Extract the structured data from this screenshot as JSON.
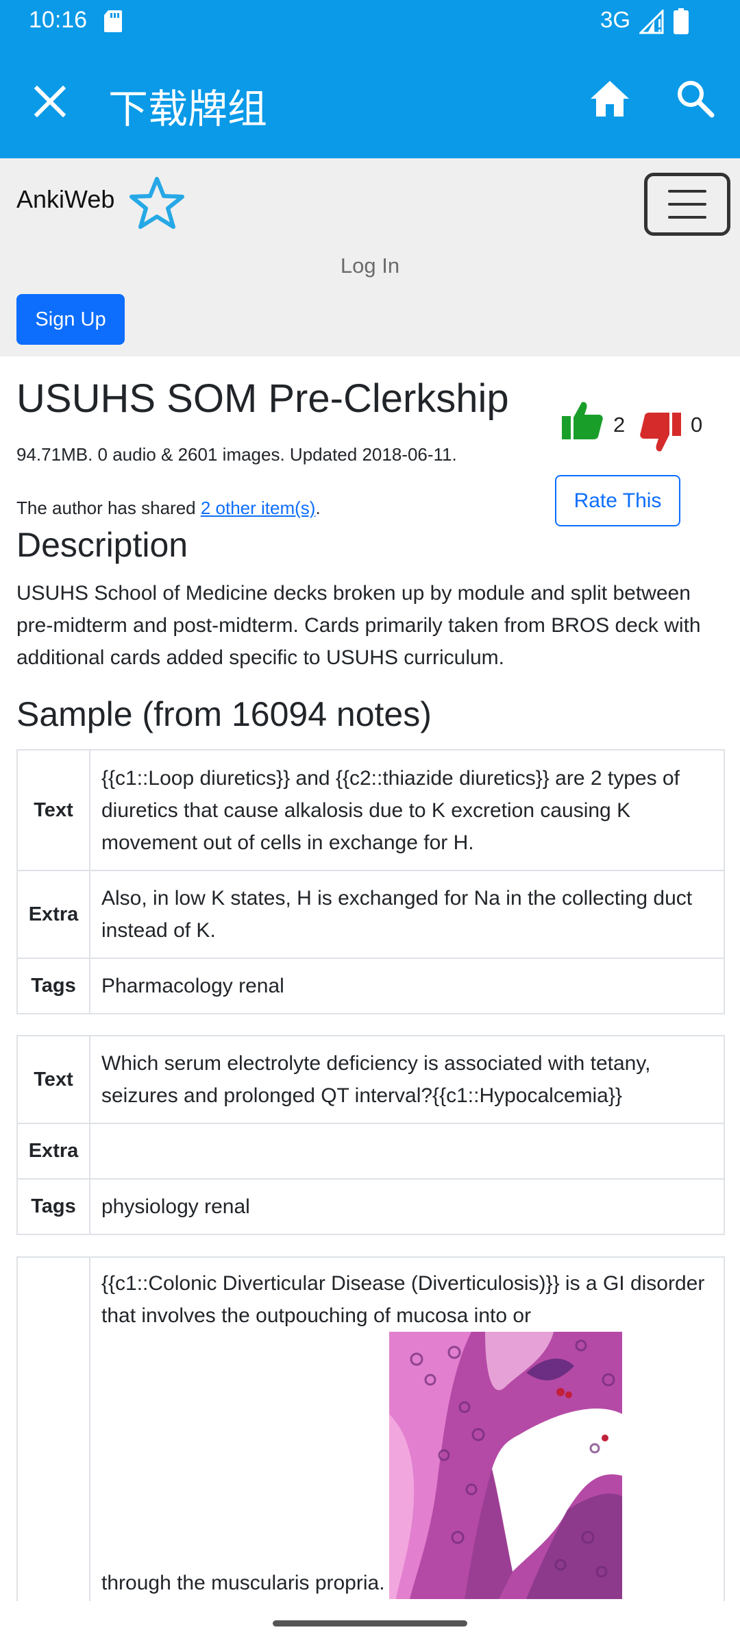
{
  "status_bar": {
    "time": "10:16",
    "network": "3G",
    "icons": [
      "sd-card-icon",
      "signal-icon",
      "battery-icon"
    ]
  },
  "app_bar": {
    "title": "下载牌组",
    "icons": [
      "close-icon",
      "home-icon",
      "search-icon"
    ]
  },
  "site_header": {
    "brand": "AnkiWeb",
    "login": "Log In",
    "signup": "Sign Up",
    "menu_icon": "hamburger-menu-icon"
  },
  "deck": {
    "title": "USUHS SOM Pre-Clerkship",
    "meta": "94.71MB. 0 audio & 2601 images. Updated 2018-06-11.",
    "shared_prefix": "The author has shared ",
    "shared_link": "2 other item(s)",
    "shared_suffix": ".",
    "thumbs_up": "2",
    "thumbs_down": "0",
    "rate_button": "Rate This"
  },
  "description": {
    "heading": "Description",
    "text": "USUHS School of Medicine decks broken up by module and split between pre-midterm and post-midterm.  Cards primarily taken from BROS deck with additional cards added specific to USUHS curriculum."
  },
  "sample": {
    "heading": "Sample (from 16094 notes)",
    "notes": [
      {
        "text_label": "Text",
        "text": "{{c1::Loop diuretics}} and {{c2::thiazide diuretics}} are 2 types of diuretics that cause alkalosis due to K excretion causing K movement out of cells in exchange for H.",
        "extra_label": "Extra",
        "extra": "Also, in low K states, H is exchanged for Na in the collecting duct instead of K.",
        "tags_label": "Tags",
        "tags": "Pharmacology renal"
      },
      {
        "text_label": "Text",
        "text": "Which serum electrolyte deficiency is associated with tetany, seizures and prolonged QT interval?{{c1::Hypocalcemia}}",
        "extra_label": "Extra",
        "extra": "",
        "tags_label": "Tags",
        "tags": "physiology renal"
      },
      {
        "text_label": "",
        "text_line1": "{{c1::Colonic Diverticular Disease (Diverticulosis)}} is a GI disorder that involves the outpouching of mucosa into or",
        "text_line2": "through the muscularis propria.",
        "image": "colon-histology-image"
      }
    ]
  },
  "colors": {
    "app_bar": "#0a9ae8",
    "header_bg": "#efefef",
    "primary": "#0d6efd",
    "thumb_up": "#1a9e2a",
    "thumb_down": "#d62b2b"
  }
}
